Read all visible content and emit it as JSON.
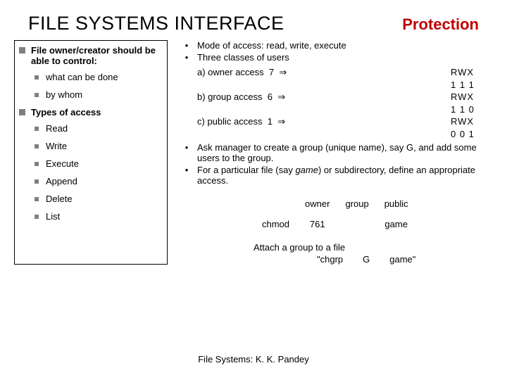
{
  "header": {
    "title": "FILE SYSTEMS INTERFACE",
    "subtitle": "Protection"
  },
  "left": {
    "item1": "File owner/creator should be able to control:",
    "sub1a": "what can be done",
    "sub1b": "by whom",
    "item2": "Types of access",
    "types": {
      "a": "Read",
      "b": "Write",
      "c": "Execute",
      "d": "Append",
      "e": "Delete",
      "f": "List"
    }
  },
  "right": {
    "b1": "Mode of access:  read, write, execute",
    "b2": "Three classes of users",
    "accessA": {
      "label": "a) owner access",
      "num": "7",
      "arrow": "⇒",
      "rwx": "RWX",
      "bits": "1 1 1"
    },
    "accessB": {
      "label": "b) group access",
      "num": "6",
      "arrow": "⇒",
      "rwx": "RWX",
      "bits": "1 1 0"
    },
    "accessC": {
      "label": "c) public access",
      "num": "1",
      "arrow": "⇒",
      "rwx": "RWX",
      "bits": "0 0 1"
    },
    "b3a": "Ask manager to create a group (unique name), say G, and add some users to the group.",
    "b4a": "For a particular file (say ",
    "b4b": "game",
    "b4c": ") or subdirectory, define an appropriate access."
  },
  "permtable": {
    "h1": "owner",
    "h2": "group",
    "h3": "public",
    "c1": "chmod",
    "c2": "761",
    "c3": "game"
  },
  "attach": {
    "line1": "Attach a group to a file",
    "a": "\"chgrp",
    "b": "G",
    "c": "game\""
  },
  "footer": "File Systems: K. K. Pandey"
}
